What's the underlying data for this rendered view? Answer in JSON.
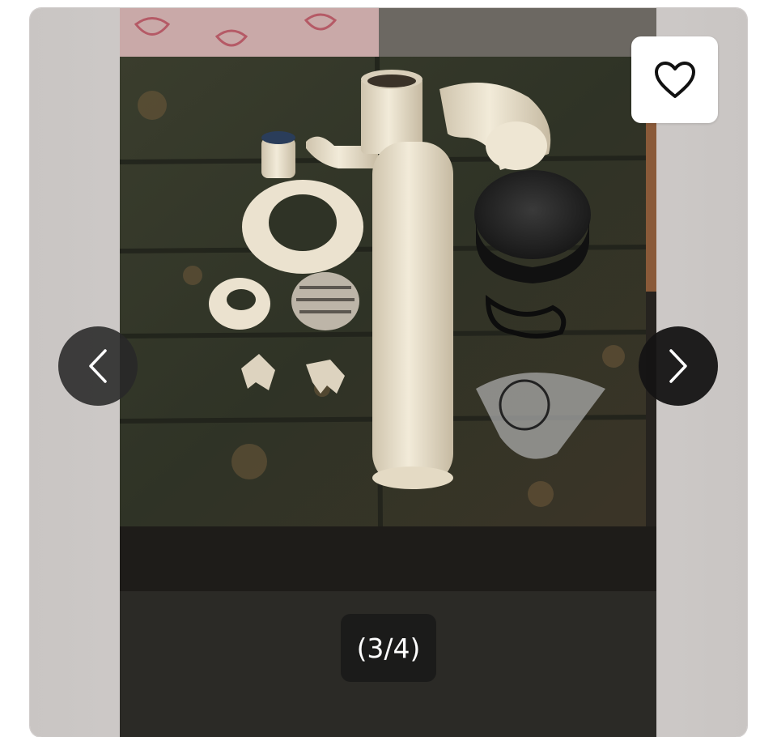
{
  "gallery": {
    "counter_text": "(3/4)",
    "current_index": 3,
    "total_images": 4,
    "favorite_icon": "heart-outline-icon",
    "prev_icon": "chevron-left-icon",
    "next_icon": "chevron-right-icon",
    "colors": {
      "viewer_background": "#d0cdcb",
      "control_dark": "#1e1e1e",
      "favorite_background": "#ffffff"
    }
  }
}
